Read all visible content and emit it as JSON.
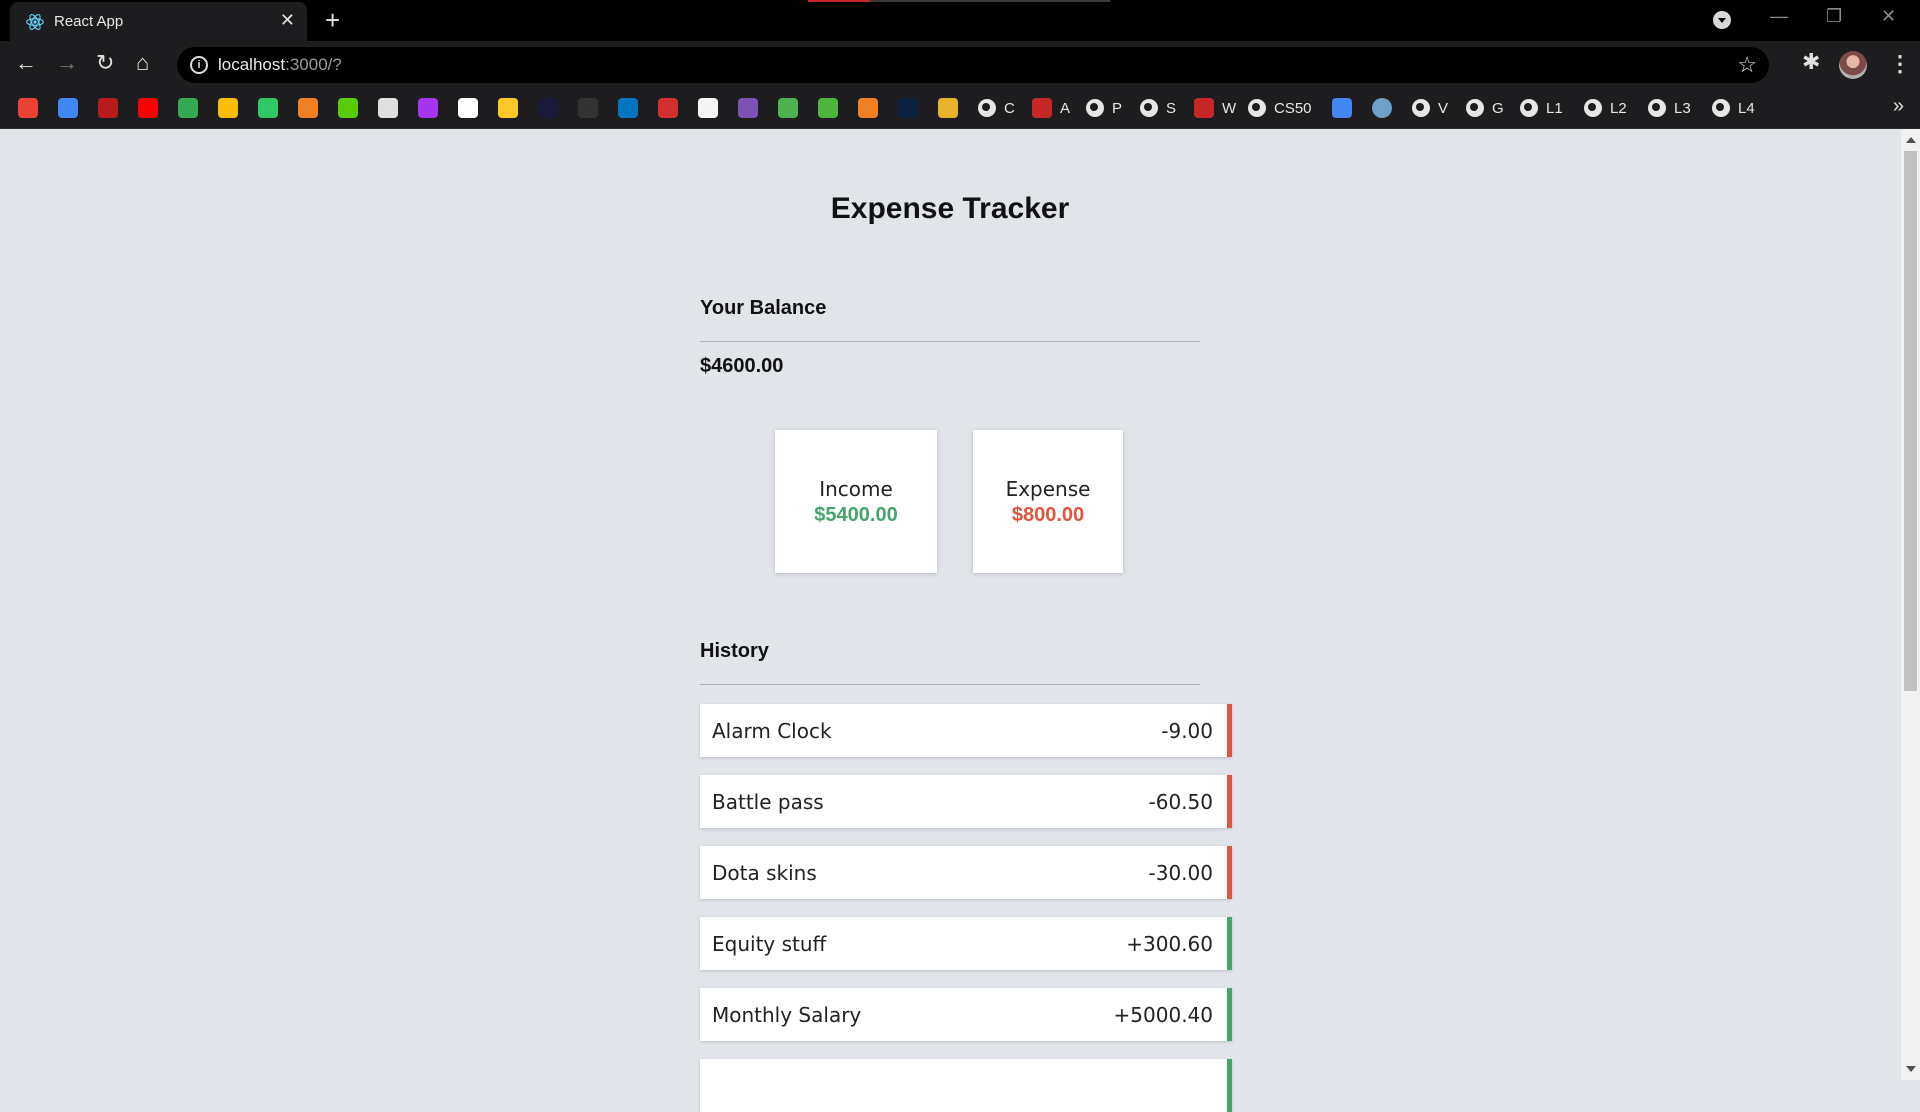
{
  "browser": {
    "tab_title": "React App",
    "url_host": "localhost",
    "url_rest": ":3000/?",
    "bookmarks": [
      {
        "label": "",
        "icon": "gmail-icon",
        "color": "#ea4335"
      },
      {
        "label": "",
        "icon": "gmail-icon",
        "color": "#4285f4"
      },
      {
        "label": "",
        "icon": "crest-icon",
        "color": "#b71c1c"
      },
      {
        "label": "",
        "icon": "youtube-icon",
        "color": "#ff0000"
      },
      {
        "label": "",
        "icon": "drive-icon",
        "color": "#34a853"
      },
      {
        "label": "",
        "icon": "chart-icon",
        "color": "#fbbc04"
      },
      {
        "label": "",
        "icon": "hackerrank-icon",
        "color": "#2ec866"
      },
      {
        "label": "",
        "icon": "stack-icon",
        "color": "#f48024"
      },
      {
        "label": "",
        "icon": "duolingo-icon",
        "color": "#58cc02"
      },
      {
        "label": "",
        "icon": "clipboard-icon",
        "color": "#e0e0e0"
      },
      {
        "label": "",
        "icon": "udemy-icon",
        "color": "#a435f0"
      },
      {
        "label": "",
        "icon": "github-icon",
        "color": "#ffffff"
      },
      {
        "label": "",
        "icon": "firebase-icon",
        "color": "#ffca28"
      },
      {
        "label": "",
        "icon": "angular-icon",
        "color": "#1a1a3a"
      },
      {
        "label": "",
        "icon": "bear-icon",
        "color": "#333333"
      },
      {
        "label": "",
        "icon": "dart-icon",
        "color": "#0175c2"
      },
      {
        "label": "",
        "icon": "red-square-icon",
        "color": "#d32f2f"
      },
      {
        "label": "",
        "icon": "coin-icon",
        "color": "#f5f5f5"
      },
      {
        "label": "",
        "icon": "bootstrap-icon",
        "color": "#7952b3"
      },
      {
        "label": "",
        "icon": "w-icon",
        "color": "#4caf50"
      },
      {
        "label": "",
        "icon": "mongodb-icon",
        "color": "#4db33d"
      },
      {
        "label": "",
        "icon": "stack-icon",
        "color": "#f48024"
      },
      {
        "label": "",
        "icon": "dark-square-icon",
        "color": "#0d2240"
      },
      {
        "label": "",
        "icon": "shield-icon",
        "color": "#e8b22c"
      }
    ],
    "named_bookmarks": [
      {
        "label": "C",
        "icon": "globe-icon"
      },
      {
        "label": "A",
        "icon": "crest-icon"
      },
      {
        "label": "P",
        "icon": "globe-icon"
      },
      {
        "label": "S",
        "icon": "globe-icon"
      },
      {
        "label": "W",
        "icon": "crest-icon"
      },
      {
        "label": "CS50",
        "icon": "globe-icon"
      },
      {
        "label": "",
        "icon": "docs-icon"
      },
      {
        "label": "",
        "icon": "circle-icon"
      },
      {
        "label": "V",
        "icon": "globe-icon"
      },
      {
        "label": "G",
        "icon": "globe-icon"
      },
      {
        "label": "L1",
        "icon": "globe-icon"
      },
      {
        "label": "L2",
        "icon": "globe-icon"
      },
      {
        "label": "L3",
        "icon": "globe-icon"
      },
      {
        "label": "L4",
        "icon": "globe-icon"
      }
    ]
  },
  "app": {
    "title": "Expense Tracker",
    "balance_label": "Your Balance",
    "balance_value": "$4600.00",
    "income_label": "Income",
    "income_value": "$5400.00",
    "expense_label": "Expense",
    "expense_value": "$800.00",
    "history_label": "History",
    "colors": {
      "income": "#45a56a",
      "expense": "#e0553f",
      "background": "#e1e4e9"
    },
    "transactions": [
      {
        "name": "Alarm Clock",
        "amount": "-9.00",
        "type": "minus"
      },
      {
        "name": "Battle pass",
        "amount": "-60.50",
        "type": "minus"
      },
      {
        "name": "Dota skins",
        "amount": "-30.00",
        "type": "minus"
      },
      {
        "name": "Equity stuff",
        "amount": "+300.60",
        "type": "plus"
      },
      {
        "name": "Monthly Salary",
        "amount": "+5000.40",
        "type": "plus"
      },
      {
        "name": "",
        "amount": "",
        "type": "plus"
      }
    ]
  }
}
